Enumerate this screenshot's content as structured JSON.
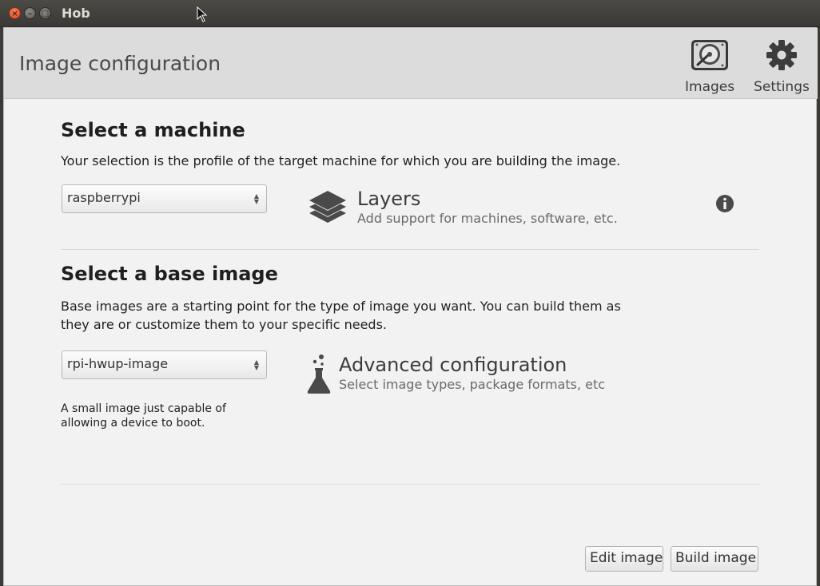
{
  "titlebar": {
    "title": "Hob"
  },
  "header": {
    "page_title": "Image configuration",
    "images_label": "Images",
    "settings_label": "Settings"
  },
  "machine": {
    "title": "Select a machine",
    "description": "Your selection is the profile of the target machine for which you are building the image.",
    "selected": "raspberrypi"
  },
  "layers": {
    "title": "Layers",
    "subtitle": "Add support for machines, software, etc."
  },
  "base_image": {
    "title": "Select a base image",
    "description_line1": "Base images are a starting point for the type of image you want. You can build them as",
    "description_line2": "they are or customize them to your specific needs.",
    "selected": "rpi-hwup-image",
    "selected_desc_line1": "A small image just capable of",
    "selected_desc_line2": "allowing a device to boot."
  },
  "advanced": {
    "title": "Advanced configuration",
    "subtitle": "Select image types, package formats, etc"
  },
  "footer": {
    "edit_label": "Edit image",
    "build_label": "Build image"
  }
}
